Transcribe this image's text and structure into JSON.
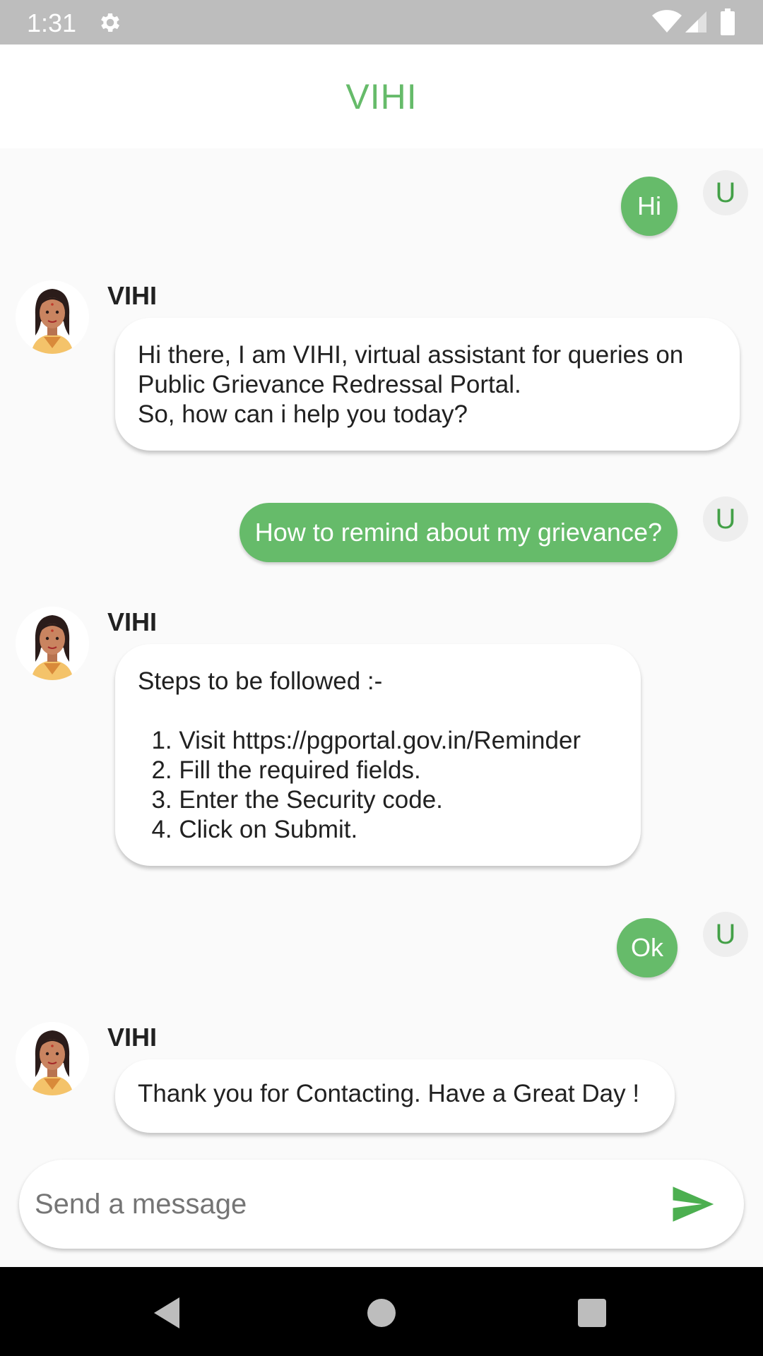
{
  "status_bar": {
    "time": "1:31",
    "icons": [
      "gear-icon",
      "wifi-icon",
      "signal-icon",
      "battery-icon"
    ]
  },
  "app_bar": {
    "title": "VIHI"
  },
  "messages": [
    {
      "from": "user",
      "avatar": "U",
      "text": "Hi"
    },
    {
      "from": "bot",
      "name": "VIHI",
      "text": "Hi there, I am VIHI, virtual assistant for queries on\nPublic Grievance Redressal Portal.\nSo, how can i help you today?"
    },
    {
      "from": "user",
      "avatar": "U",
      "text": "How to remind about my grievance?"
    },
    {
      "from": "bot",
      "name": "VIHI",
      "text": "Steps to be followed :-\n\n  1. Visit https://pgportal.gov.in/Reminder\n  2. Fill the required fields.\n  3. Enter the Security code.\n  4. Click on Submit."
    },
    {
      "from": "user",
      "avatar": "U",
      "text": "Ok"
    },
    {
      "from": "bot",
      "name": "VIHI",
      "text": "Thank you for Contacting. Have a Great Day !"
    }
  ],
  "composer": {
    "placeholder": "Send a message",
    "value": "",
    "send_icon": "send-icon"
  },
  "colors": {
    "accent": "#66bb6a",
    "user_avatar_text": "#43a047",
    "status_bar": "#bdbdbd"
  },
  "nav_bar": {
    "icons": [
      "back-icon",
      "home-icon",
      "recents-icon"
    ]
  }
}
